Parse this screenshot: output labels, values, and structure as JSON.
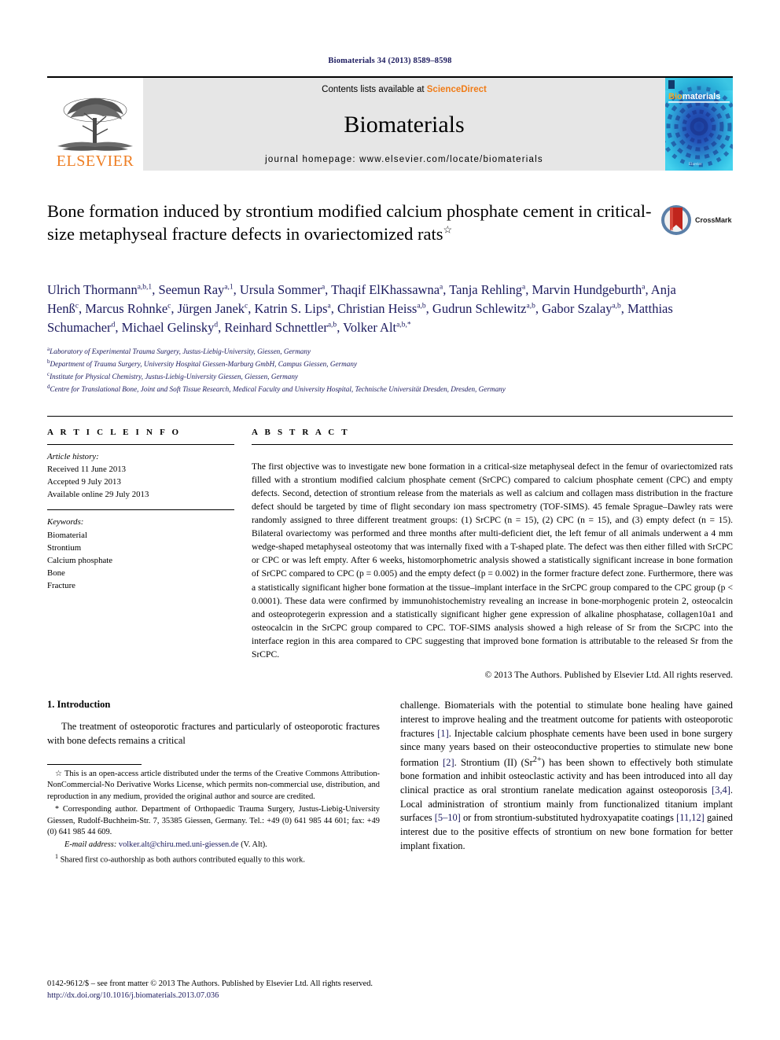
{
  "running_head": "Biomaterials 34 (2013) 8589–8598",
  "masthead": {
    "publisher": "ELSEVIER",
    "contents_prefix": "Contents lists available at ",
    "contents_link": "ScienceDirect",
    "journal_name": "Biomaterials",
    "homepage": "journal homepage: www.elsevier.com/locate/biomaterials",
    "cover_title_a": "Bio",
    "cover_title_b": "materials",
    "cover_footer": "Elsevier"
  },
  "title": {
    "text": "Bone formation induced by strontium modified calcium phosphate cement in critical-size metaphyseal fracture defects in ovariectomized rats",
    "marker": "☆",
    "crossmark_label": "CrossMark"
  },
  "authors": [
    {
      "name": "Ulrich Thormann",
      "sup": "a,b,1",
      "sep": ", "
    },
    {
      "name": "Seemun Ray",
      "sup": "a,1",
      "sep": ", "
    },
    {
      "name": "Ursula Sommer",
      "sup": "a",
      "sep": ", "
    },
    {
      "name": "Thaqif ElKhassawna",
      "sup": "a",
      "sep": ", "
    },
    {
      "name": "Tanja Rehling",
      "sup": "a",
      "sep": ", "
    },
    {
      "name": "Marvin Hundgeburth",
      "sup": "a",
      "sep": ", "
    },
    {
      "name": "Anja Henß",
      "sup": "c",
      "sep": ", "
    },
    {
      "name": "Marcus Rohnke",
      "sup": "c",
      "sep": ", "
    },
    {
      "name": "Jürgen Janek",
      "sup": "c",
      "sep": ", "
    },
    {
      "name": "Katrin S. Lips",
      "sup": "a",
      "sep": ", "
    },
    {
      "name": "Christian Heiss",
      "sup": "a,b",
      "sep": ", "
    },
    {
      "name": "Gudrun Schlewitz",
      "sup": "a,b",
      "sep": ", "
    },
    {
      "name": "Gabor Szalay",
      "sup": "a,b",
      "sep": ", "
    },
    {
      "name": "Matthias Schumacher",
      "sup": "d",
      "sep": ", "
    },
    {
      "name": "Michael Gelinsky",
      "sup": "d",
      "sep": ", "
    },
    {
      "name": "Reinhard Schnettler",
      "sup": "a,b",
      "sep": ", "
    },
    {
      "name": "Volker Alt",
      "sup": "a,b,*",
      "sep": ""
    }
  ],
  "affiliations": [
    {
      "label": "a",
      "text": "Laboratory of Experimental Trauma Surgery, Justus-Liebig-University, Giessen, Germany"
    },
    {
      "label": "b",
      "text": "Department of Trauma Surgery, University Hospital Giessen-Marburg GmbH, Campus Giessen, Germany"
    },
    {
      "label": "c",
      "text": "Institute for Physical Chemistry, Justus-Liebig-University Giessen, Giessen, Germany"
    },
    {
      "label": "d",
      "text": "Centre for Translational Bone, Joint and Soft Tissue Research, Medical Faculty and University Hospital, Technische Universität Dresden, Dresden, Germany"
    }
  ],
  "article_info": {
    "heading": "A R T I C L E   I N F O",
    "history_title": "Article history:",
    "history": [
      "Received 11 June 2013",
      "Accepted 9 July 2013",
      "Available online 29 July 2013"
    ],
    "keywords_title": "Keywords:",
    "keywords": [
      "Biomaterial",
      "Strontium",
      "Calcium phosphate",
      "Bone",
      "Fracture"
    ]
  },
  "abstract": {
    "heading": "A B S T R A C T",
    "text": "The first objective was to investigate new bone formation in a critical-size metaphyseal defect in the femur of ovariectomized rats filled with a strontium modified calcium phosphate cement (SrCPC) compared to calcium phosphate cement (CPC) and empty defects. Second, detection of strontium release from the materials as well as calcium and collagen mass distribution in the fracture defect should be targeted by time of flight secondary ion mass spectrometry (TOF-SIMS). 45 female Sprague–Dawley rats were randomly assigned to three different treatment groups: (1) SrCPC (n = 15), (2) CPC (n = 15), and (3) empty defect (n = 15). Bilateral ovariectomy was performed and three months after multi-deficient diet, the left femur of all animals underwent a 4 mm wedge-shaped metaphyseal osteotomy that was internally fixed with a T-shaped plate. The defect was then either filled with SrCPC or CPC or was left empty. After 6 weeks, histomorphometric analysis showed a statistically significant increase in bone formation of SrCPC compared to CPC (p = 0.005) and the empty defect (p = 0.002) in the former fracture defect zone. Furthermore, there was a statistically significant higher bone formation at the tissue–implant interface in the SrCPC group compared to the CPC group (p < 0.0001). These data were confirmed by immunohistochemistry revealing an increase in bone-morphogenic protein 2, osteocalcin and osteoprotegerin expression and a statistically significant higher gene expression of alkaline phosphatase, collagen10a1 and osteocalcin in the SrCPC group compared to CPC. TOF-SIMS analysis showed a high release of Sr from the SrCPC into the interface region in this area compared to CPC suggesting that improved bone formation is attributable to the released Sr from the SrCPC.",
    "copyright": "© 2013 The Authors. Published by Elsevier Ltd. All rights reserved."
  },
  "introduction": {
    "heading": "1.  Introduction",
    "left_para": "The treatment of osteoporotic fractures and particularly of osteoporotic fractures with bone defects remains a critical",
    "right_para_parts": [
      {
        "t": "challenge. Biomaterials with the potential to stimulate bone healing have gained interest to improve healing and the treatment outcome for patients with osteoporotic fractures ",
        "k": "text"
      },
      {
        "t": "[1]",
        "k": "ref"
      },
      {
        "t": ". Injectable calcium phosphate cements have been used in bone surgery since many years based on their osteoconductive properties to stimulate new bone formation ",
        "k": "text"
      },
      {
        "t": "[2]",
        "k": "ref"
      },
      {
        "t": ". Strontium (II) (Sr",
        "k": "text"
      },
      {
        "t": "2+",
        "k": "sup"
      },
      {
        "t": ") has been shown to effectively both stimulate bone formation and inhibit osteoclastic activity and has been introduced into all day clinical practice as oral strontium ranelate medication against osteoporosis ",
        "k": "text"
      },
      {
        "t": "[3,4]",
        "k": "ref"
      },
      {
        "t": ". Local administration of strontium mainly from functionalized titanium implant surfaces ",
        "k": "text"
      },
      {
        "t": "[5–10]",
        "k": "ref"
      },
      {
        "t": " or from strontium-substituted hydroxyapatite coatings ",
        "k": "text"
      },
      {
        "t": "[11,12]",
        "k": "ref"
      },
      {
        "t": " gained interest due to the positive effects of strontium on new bone formation for better implant fixation.",
        "k": "text"
      }
    ]
  },
  "footnotes": {
    "license_marker": "☆",
    "license": "This is an open-access article distributed under the terms of the Creative Commons Attribution-NonCommercial-No Derivative Works License, which permits non-commercial use, distribution, and reproduction in any medium, provided the original author and source are credited.",
    "corresponding_marker": "*",
    "corresponding": "Corresponding author. Department of Orthopaedic Trauma Surgery, Justus-Liebig-University Giessen, Rudolf-Buchheim-Str. 7, 35385 Giessen, Germany. Tel.: +49 (0) 641 985 44 601; fax: +49 (0) 641 985 44 609.",
    "email_label": "E-mail address:",
    "email": "volker.alt@chiru.med.uni-giessen.de",
    "email_suffix": "(V. Alt).",
    "shared_marker": "1",
    "shared": "Shared first co-authorship as both authors contributed equally to this work."
  },
  "page_footer": {
    "issn_line": "0142-9612/$ – see front matter © 2013 The Authors. Published by Elsevier Ltd. All rights reserved.",
    "doi": "http://dx.doi.org/10.1016/j.biomaterials.2013.07.036"
  },
  "colors": {
    "elsevier_orange": "#ee7e23",
    "sciencedirect_orange": "#f07c18",
    "link_navy": "#1b1a5e",
    "band_gray": "#e6e6e6",
    "cover_cyan": "#27c6e8",
    "crossmark_blue": "#2f6fa8",
    "crossmark_red": "#c0251c"
  }
}
